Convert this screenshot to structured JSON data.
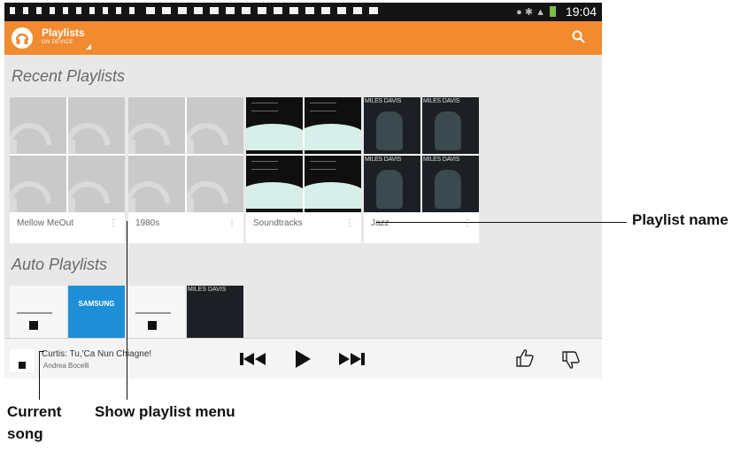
{
  "status_bar": {
    "time": "19:04"
  },
  "action_bar": {
    "title": "Playlists",
    "subtitle": "ON DEVICE"
  },
  "sections": {
    "recent": "Recent Playlists",
    "auto": "Auto Playlists"
  },
  "recent_playlists": [
    {
      "name": "Mellow MeOut"
    },
    {
      "name": "1980s"
    },
    {
      "name": "Soundtracks"
    },
    {
      "name": "Jazz"
    }
  ],
  "album_text": {
    "jazz_art": "MILES DAVIS",
    "samsung_art": "SAMSUNG"
  },
  "now_playing": {
    "title": "Curtis: Tu,'Ca Nun Chiagne!",
    "artist": "Andrea Bocelli"
  },
  "callouts": {
    "playlist_name": "Playlist name",
    "current_song_line1": "Current",
    "current_song_line2": "song",
    "show_playlist_menu": "Show playlist menu"
  },
  "colors": {
    "action_bar": "#f28a2f",
    "status_bar": "#141414",
    "battery": "#7bc043"
  }
}
